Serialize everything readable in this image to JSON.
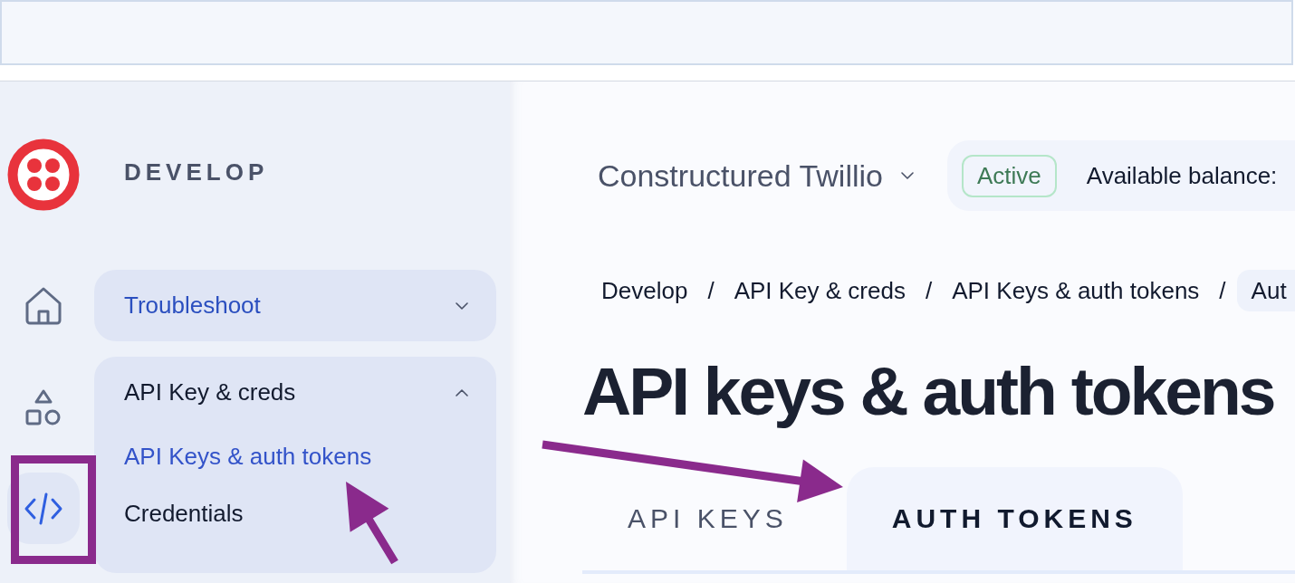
{
  "sidebar": {
    "section_title": "DEVELOP",
    "rail": [
      {
        "kind": "home",
        "selected": false
      },
      {
        "kind": "shapes",
        "selected": false
      },
      {
        "kind": "code",
        "selected": true
      }
    ],
    "groups": [
      {
        "label": "Troubleshoot",
        "expanded": false,
        "highlighted": true
      },
      {
        "label": "API Key & creds",
        "expanded": true,
        "highlighted": false,
        "children": [
          {
            "label": "API Keys & auth tokens",
            "selected": true
          },
          {
            "label": "Credentials",
            "selected": false
          }
        ]
      }
    ]
  },
  "header": {
    "project": "Constructured Twillio",
    "status": "Active",
    "balance_label": "Available balance:"
  },
  "breadcrumbs": [
    {
      "kind": "link",
      "label": "Develop"
    },
    {
      "kind": "separator",
      "label": "/"
    },
    {
      "kind": "link",
      "label": "API Key & creds"
    },
    {
      "kind": "separator",
      "label": "/"
    },
    {
      "kind": "link",
      "label": "API Keys & auth tokens"
    },
    {
      "kind": "separator",
      "label": "/"
    },
    {
      "kind": "current",
      "label": "Aut"
    }
  ],
  "title": "API keys & auth tokens",
  "tabs": [
    {
      "label": "API KEYS",
      "selected": false
    },
    {
      "label": "AUTH TOKENS",
      "selected": true
    }
  ]
}
